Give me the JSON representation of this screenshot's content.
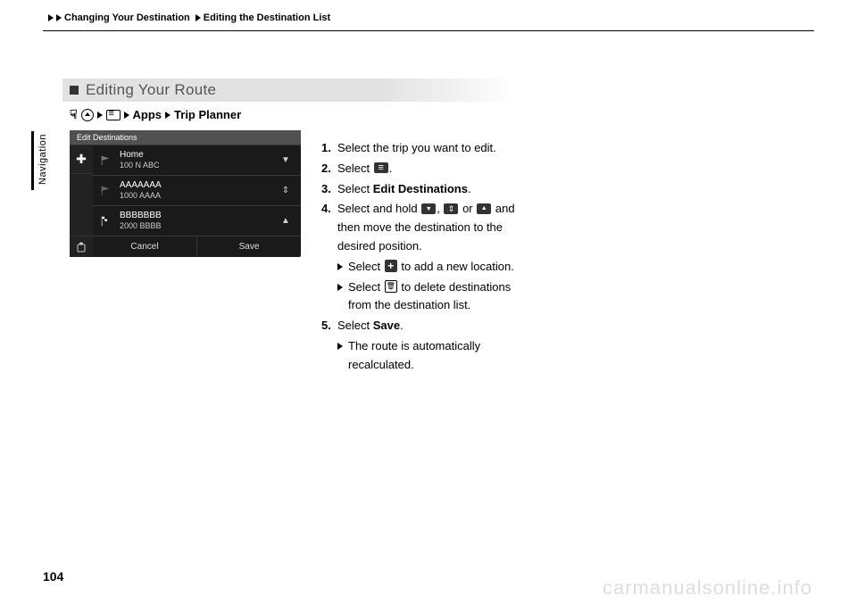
{
  "breadcrumb": {
    "level1": "Changing Your Destination",
    "level2": "Editing the Destination List"
  },
  "side_tab": "Navigation",
  "section_title": "Editing Your Route",
  "nav_path": {
    "apps": "Apps",
    "trip_planner": "Trip Planner"
  },
  "screen": {
    "header": "Edit Destinations",
    "rows": [
      {
        "title": "Home",
        "sub": "100 N ABC"
      },
      {
        "title": "AAAAAAA",
        "sub": "1000 AAAA"
      },
      {
        "title": "BBBBBBB",
        "sub": "2000 BBBB"
      }
    ],
    "cancel": "Cancel",
    "save": "Save"
  },
  "steps": {
    "s1": "Select the trip you want to edit.",
    "s2a": "Select ",
    "s2b": ".",
    "s3a": "Select ",
    "s3b": "Edit Destinations",
    "s3c": ".",
    "s4a": "Select and hold ",
    "s4b": ", ",
    "s4c": " or ",
    "s4d": " and then move the destination to the desired position.",
    "s4sub1a": "Select ",
    "s4sub1b": " to add a new location.",
    "s4sub2a": "Select ",
    "s4sub2b": " to delete destinations from the destination list.",
    "s5a": "Select ",
    "s5b": "Save",
    "s5c": ".",
    "s5sub": "The route is automatically recalculated."
  },
  "page_number": "104",
  "watermark": "carmanualsonline.info"
}
